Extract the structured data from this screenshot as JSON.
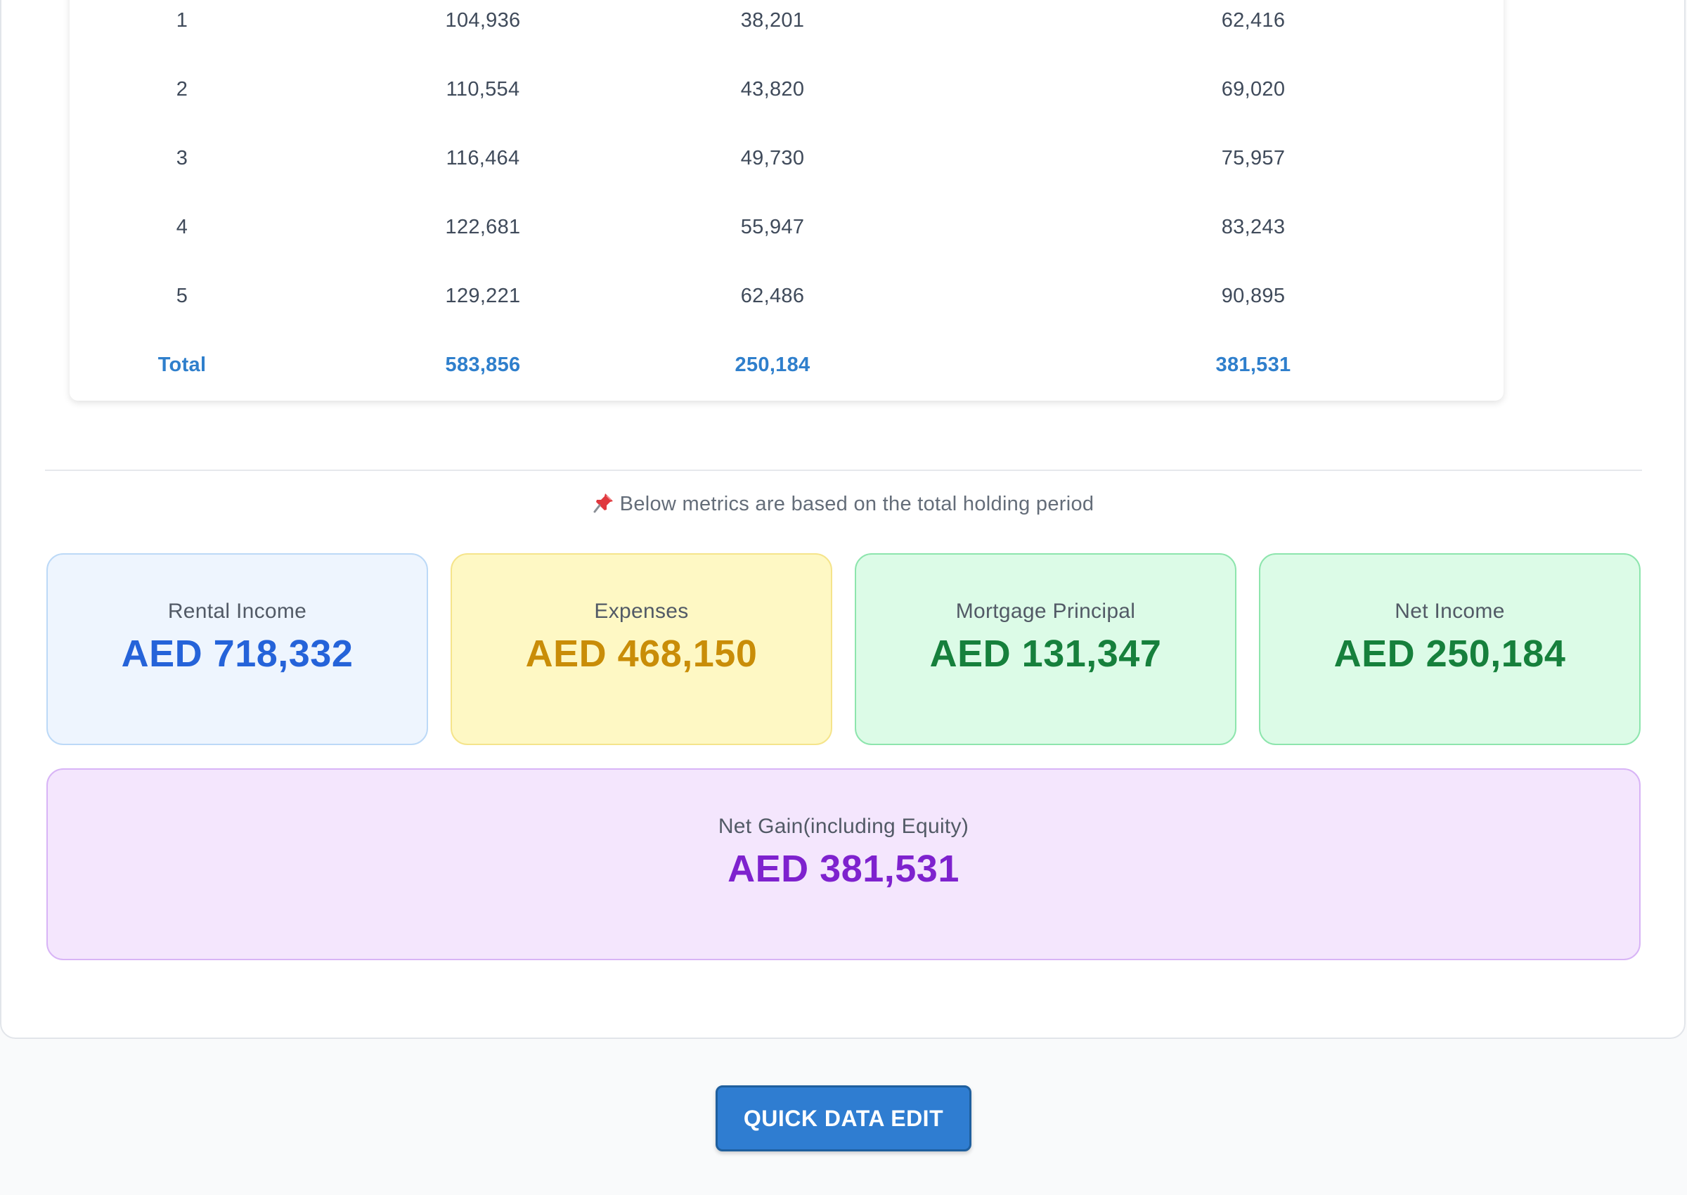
{
  "yearly_table": {
    "rows": [
      {
        "year": "1",
        "rental_income": "104,936",
        "net_cash_flow": "38,201",
        "net_gain": "62,416"
      },
      {
        "year": "2",
        "rental_income": "110,554",
        "net_cash_flow": "43,820",
        "net_gain": "69,020"
      },
      {
        "year": "3",
        "rental_income": "116,464",
        "net_cash_flow": "49,730",
        "net_gain": "75,957"
      },
      {
        "year": "4",
        "rental_income": "122,681",
        "net_cash_flow": "55,947",
        "net_gain": "83,243"
      },
      {
        "year": "5",
        "rental_income": "129,221",
        "net_cash_flow": "62,486",
        "net_gain": "90,895"
      }
    ],
    "total": {
      "label": "Total",
      "rental_income": "583,856",
      "net_cash_flow": "250,184",
      "net_gain": "381,531"
    }
  },
  "note": {
    "icon": "pushpin-icon",
    "text": "Below metrics are based on the total holding period"
  },
  "metrics": {
    "rental_income": {
      "label": "Rental Income",
      "value": "AED 718,332",
      "color": "#2563d9"
    },
    "expenses": {
      "label": "Expenses",
      "value": "AED 468,150",
      "color": "#c98d08"
    },
    "mortgage_principal": {
      "label": "Mortgage Principal",
      "value": "AED 131,347",
      "color": "#16803c"
    },
    "net_income": {
      "label": "Net Income",
      "value": "AED 250,184",
      "color": "#16803c"
    },
    "net_gain": {
      "label": "Net Gain(including Equity)",
      "value": "AED 381,531",
      "color": "#7e22ce"
    }
  },
  "actions": {
    "quick_edit_label": "QUICK DATA EDIT"
  }
}
